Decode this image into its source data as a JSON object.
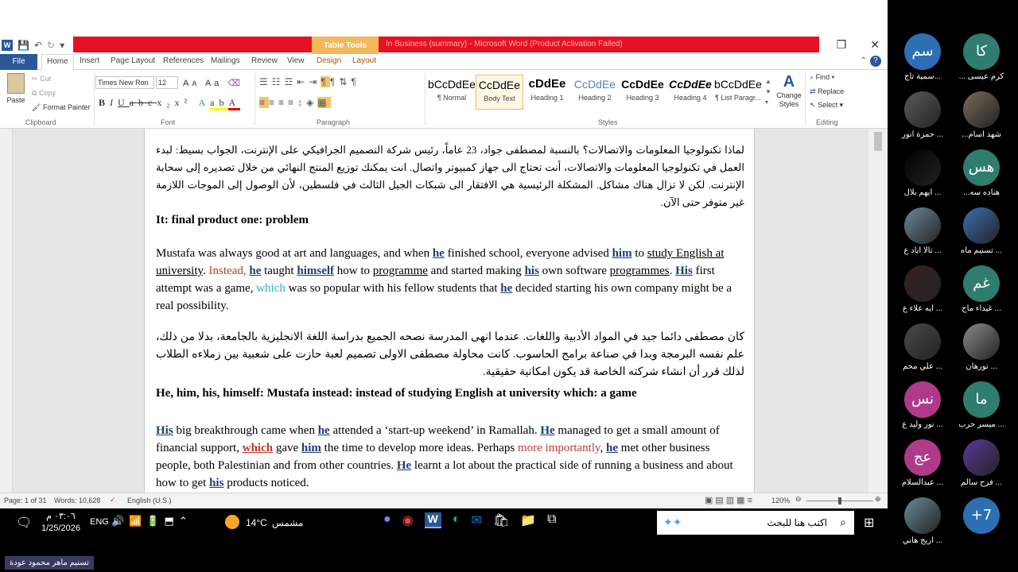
{
  "window": {
    "title": "In Business (summary) - Microsoft Word (Product Activation Failed)",
    "context_tab": "Table Tools"
  },
  "tabs": [
    "File",
    "Home",
    "Insert",
    "Page Layout",
    "References",
    "Mailings",
    "Review",
    "View",
    "Design",
    "Layout"
  ],
  "ribbon": {
    "clipboard": {
      "paste": "Paste",
      "cut": "Cut",
      "copy": "Copy",
      "format_painter": "Format Painter",
      "label": "Clipboard"
    },
    "font": {
      "name": "Times New Ron",
      "size": "12",
      "label": "Font"
    },
    "paragraph": {
      "label": "Paragraph"
    },
    "styles": {
      "label": "Styles",
      "items": [
        {
          "preview": "bCcDdEe",
          "name": "¶ Normal"
        },
        {
          "preview": "CcDdEe",
          "name": "Body Text"
        },
        {
          "preview": "cDdEe",
          "name": "Heading 1"
        },
        {
          "preview": "CcDdEe",
          "name": "Heading 2"
        },
        {
          "preview": "CcDdEe",
          "name": "Heading 3"
        },
        {
          "preview": "CcDdEe",
          "name": "Heading 4"
        },
        {
          "preview": "bCcDdEe",
          "name": "¶ List Paragr..."
        }
      ],
      "change_styles": "Change Styles"
    },
    "editing": {
      "find": "Find",
      "replace": "Replace",
      "select": "Select",
      "label": "Editing"
    }
  },
  "document": {
    "arabic1": "لماذا تكنولوجيا المعلومات والاتصالات؟ بالنسبة لمصطفى جواد، 23 عاماً، رئيس شركة التصميم الجرافيكي على الإنترنت، الجواب بسيط: لبدء العمل في تكنولوجيا المعلومات والاتصالات، أنت تحتاج الى جهاز كمبيوتر واتصال. انت يمكنك توزيع المنتج النهائي من خلال تصديره إلى سحابة الإنترنت. لكن لا تزال هناك مشاكل. المشكلة الرئيسية هي الافتقار الى شبكات الجيل الثالث في فلسطين، لأن الوصول إلى الموجات اللازمة غير متوفر حتى الآن.",
    "heading1": "It:  final product        one:  problem",
    "para1": {
      "t1": "Mustafa was always good at art and languages, and when ",
      "w1": "he",
      "t2": " finished school, everyone advised ",
      "w2": "him",
      "t3": " to ",
      "w3": "study English at university",
      "t4": ". ",
      "w4": "Instead,",
      "t5": " ",
      "w5": "he",
      "t6": " taught ",
      "w6": "himself",
      "t7": " how to ",
      "w7": "programme",
      "t8": " and started making ",
      "w8": "his",
      "t9": " own software ",
      "w9": "programmes",
      "t10": ".  ",
      "w10": "His",
      "t11": " first attempt was a game, ",
      "w11": "which",
      "t12": " was so popular with his fellow students that ",
      "w12": "he",
      "t13": " decided starting his own company might be a real possibility."
    },
    "arabic2": "كان مصطفى دائما جيد في المواد الأدبية واللغات. عندما انهى المدرسة نصحه الجميع بدراسة اللغة الانجليزية بالجامعة، بدلا من ذلك، علم نفسه البرمجة وبدا في صناعة برامج الحاسوب. كانت محاولة مصطفى الاولى تصميم لعبة حازت على شعبية بين زملاءه الطلاب لذلك قرر أن انشاء شركته الخاصة قد يكون امكانية حقيقية.",
    "heading2": "He, him, his, himself: Mustafa     instead: instead of studying English at university       which: a game",
    "para2": {
      "w1": "His",
      "t1": " big breakthrough came when ",
      "w2": "he",
      "t2": " attended a ‘start-up weekend’ in Ramallah. ",
      "w3": "He",
      "t3": " managed to get a small amount of financial support, ",
      "w4": "which",
      "t4": " gave ",
      "w5": "him",
      "t5": " the time to develop more ideas. Perhaps ",
      "w6": "more importantly",
      "t6": ", ",
      "w7": "he",
      "t7": " met other business people, both Palestinian and from other countries. ",
      "w8": "He",
      "t8": " learnt a lot about the practical side of running a business and about how to get ",
      "w9": "his",
      "t9": " products noticed."
    }
  },
  "status": {
    "page": "Page: 1 of 31",
    "words": "Words: 10,628",
    "language": "English (U.S.)",
    "zoom": "120%"
  },
  "taskbar": {
    "time": "٠٣:٠٦ م",
    "date": "1/25/2026",
    "lang": "ENG",
    "temp": "14°C",
    "weather": "مشمس",
    "search_placeholder": "اكتب هنا للبحث"
  },
  "bottom_label": "تسنيم ماهر محمود عودة",
  "participants": [
    {
      "initials": "سم",
      "name": "...سمية تاج",
      "color": "#2d6fb3",
      "photo": false
    },
    {
      "initials": "كا",
      "name": "كرم عيسى ...",
      "color": "#2e7d6f",
      "photo": false
    },
    {
      "initials": "",
      "name": "... حمزة أنور",
      "color": "#5b5b5b",
      "photo": true
    },
    {
      "initials": "",
      "name": "شهد اسام...",
      "color": "#7a6a5a",
      "photo": true
    },
    {
      "initials": "",
      "name": "... أيهم بلال",
      "color": "#000000",
      "photo": true
    },
    {
      "initials": "هس",
      "name": "هناده سه...",
      "color": "#2e7d6f",
      "photo": false
    },
    {
      "initials": "",
      "name": "... تالا اياد ع",
      "color": "#6b8a9a",
      "photo": true
    },
    {
      "initials": "",
      "name": "... تسنيم ماه",
      "color": "#3a6fb0",
      "photo": true
    },
    {
      "initials": "",
      "name": "... ايه علاء ع",
      "color": "#3a2020",
      "photo": true
    },
    {
      "initials": "غم",
      "name": "... غيداء ماج",
      "color": "#2e7d6f",
      "photo": false
    },
    {
      "initials": "",
      "name": "... علي محم",
      "color": "#4a4a4a",
      "photo": true
    },
    {
      "initials": "",
      "name": "... تورهان",
      "color": "#8a8a8a",
      "photo": true
    },
    {
      "initials": "نس",
      "name": "... نور وليد ع",
      "color": "#b03a8a",
      "photo": false
    },
    {
      "initials": "ما",
      "name": "... ميسر حرب",
      "color": "#2e7d6f",
      "photo": false
    },
    {
      "initials": "عج",
      "name": "... عبدالسلام",
      "color": "#b03a8a",
      "photo": false
    },
    {
      "initials": "",
      "name": "... فرح سالم",
      "color": "#5a3a9a",
      "photo": true
    },
    {
      "initials": "",
      "name": "... اريج هاني",
      "color": "#6a8a9a",
      "photo": true
    },
    {
      "initials": "+7",
      "name": "",
      "color": "#2d6fb3",
      "photo": false
    }
  ]
}
